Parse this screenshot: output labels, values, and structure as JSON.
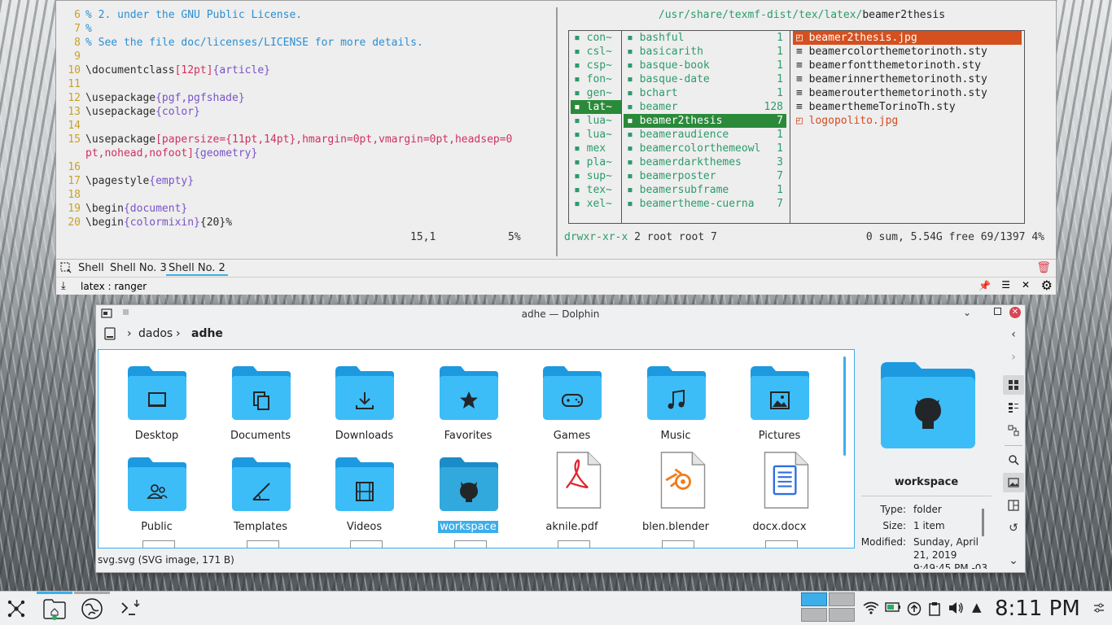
{
  "vim": {
    "lines": [
      {
        "n": "6",
        "parts": [
          {
            "t": "% 2. under the GNU Public License.",
            "c": "c-comment"
          }
        ]
      },
      {
        "n": "7",
        "parts": [
          {
            "t": "%",
            "c": "c-comment"
          }
        ]
      },
      {
        "n": "8",
        "parts": [
          {
            "t": "% See the file doc/licenses/LICENSE for more details.",
            "c": "c-comment"
          }
        ]
      },
      {
        "n": "9",
        "parts": []
      },
      {
        "n": "10",
        "parts": [
          {
            "t": "\\documentclass",
            "c": "c-cmd"
          },
          {
            "t": "[12pt]",
            "c": "c-opt"
          },
          {
            "t": "{article}",
            "c": "c-arg"
          }
        ]
      },
      {
        "n": "11",
        "parts": []
      },
      {
        "n": "12",
        "parts": [
          {
            "t": "\\usepackage",
            "c": "c-cmd"
          },
          {
            "t": "{pgf,pgfshade}",
            "c": "c-arg"
          }
        ]
      },
      {
        "n": "13",
        "parts": [
          {
            "t": "\\usepackage",
            "c": "c-cmd"
          },
          {
            "t": "{color}",
            "c": "c-arg"
          }
        ]
      },
      {
        "n": "14",
        "parts": []
      },
      {
        "n": "15",
        "parts": [
          {
            "t": "\\usepackage",
            "c": "c-cmd"
          },
          {
            "t": "[papersize={11pt,14pt},hmargin=0pt,vmargin=0pt,headsep=0",
            "c": "c-opt"
          }
        ]
      },
      {
        "n": "",
        "parts": [
          {
            "t": "pt,nohead,nofoot]",
            "c": "c-opt"
          },
          {
            "t": "{geometry}",
            "c": "c-arg"
          }
        ]
      },
      {
        "n": "16",
        "parts": []
      },
      {
        "n": "17",
        "parts": [
          {
            "t": "\\pagestyle",
            "c": "c-cmd"
          },
          {
            "t": "{empty}",
            "c": "c-arg"
          }
        ]
      },
      {
        "n": "18",
        "parts": []
      },
      {
        "n": "19",
        "parts": [
          {
            "t": "\\begin",
            "c": "c-cmd"
          },
          {
            "t": "{document}",
            "c": "c-arg"
          }
        ]
      },
      {
        "n": "20",
        "parts": [
          {
            "t": "\\begin",
            "c": "c-cmd"
          },
          {
            "t": "{colormixin}",
            "c": "c-arg"
          },
          {
            "t": "{20}%",
            "c": "c-cmd"
          }
        ]
      }
    ],
    "status_pos": "15,1",
    "status_pct": "5%"
  },
  "ranger": {
    "path_prefix": "/usr/share/texmf-dist/tex/latex/",
    "path_current": "beamer2thesis",
    "parent": [
      "con~",
      "csl~",
      "csp~",
      "fon~",
      "gen~",
      "lat~",
      "lua~",
      "lua~",
      "mex",
      "pla~",
      "sup~",
      "tex~",
      "xel~"
    ],
    "parent_selected": 5,
    "current": [
      {
        "name": "bashful",
        "count": "1"
      },
      {
        "name": "basicarith",
        "count": "1"
      },
      {
        "name": "basque-book",
        "count": "1"
      },
      {
        "name": "basque-date",
        "count": "1"
      },
      {
        "name": "bchart",
        "count": "1"
      },
      {
        "name": "beamer",
        "count": "128"
      },
      {
        "name": "beamer2thesis",
        "count": "7"
      },
      {
        "name": "beameraudience",
        "count": "1"
      },
      {
        "name": "beamercolorthemeowl",
        "count": "1"
      },
      {
        "name": "beamerdarkthemes",
        "count": "3"
      },
      {
        "name": "beamerposter",
        "count": "7"
      },
      {
        "name": "beamersubframe",
        "count": "1"
      },
      {
        "name": "beamertheme-cuerna",
        "count": "7"
      }
    ],
    "current_selected": 6,
    "preview": [
      {
        "name": "beamer2thesis.jpg",
        "kind": "imgsel"
      },
      {
        "name": "beamercolorthemetorinoth.sty",
        "kind": "file"
      },
      {
        "name": "beamerfontthemetorinoth.sty",
        "kind": "file"
      },
      {
        "name": "beamerinnerthemetorinoth.sty",
        "kind": "file"
      },
      {
        "name": "beamerouterthemetorinoth.sty",
        "kind": "file"
      },
      {
        "name": "beamerthemeTorinoTh.sty",
        "kind": "file"
      },
      {
        "name": "logopolito.jpg",
        "kind": "img"
      }
    ],
    "status_perm": "drwxr-xr-x",
    "status_owner": "2 root root 7",
    "status_right": "0 sum, 5.54G free  69/1397   4%"
  },
  "yakuake": {
    "tabs": [
      "Shell",
      "Shell No. 3",
      "Shell No. 2"
    ],
    "active_tab": 2,
    "session_title": "latex : ranger"
  },
  "dolphin": {
    "title": "adhe — Dolphin",
    "crumbs": [
      "dados",
      "adhe"
    ],
    "items": [
      {
        "label": "Desktop",
        "type": "folder",
        "glyph": "desktop-icon"
      },
      {
        "label": "Documents",
        "type": "folder",
        "glyph": "documents-icon"
      },
      {
        "label": "Downloads",
        "type": "folder",
        "glyph": "download-icon"
      },
      {
        "label": "Favorites",
        "type": "folder",
        "glyph": "star-icon"
      },
      {
        "label": "Games",
        "type": "folder",
        "glyph": "gamepad-icon"
      },
      {
        "label": "Music",
        "type": "folder",
        "glyph": "music-icon"
      },
      {
        "label": "Pictures",
        "type": "folder",
        "glyph": "picture-icon"
      },
      {
        "label": "Public",
        "type": "folder",
        "glyph": "people-icon"
      },
      {
        "label": "Templates",
        "type": "folder",
        "glyph": "templates-icon"
      },
      {
        "label": "Videos",
        "type": "folder",
        "glyph": "film-icon"
      },
      {
        "label": "workspace",
        "type": "folder",
        "glyph": "github-icon"
      },
      {
        "label": "aknile.pdf",
        "type": "file",
        "glyph": "pdf-icon"
      },
      {
        "label": "blen.blender",
        "type": "file",
        "glyph": "blender-icon"
      },
      {
        "label": "docx.docx",
        "type": "file",
        "glyph": "document-icon"
      }
    ],
    "selected_index": 10,
    "status": "svg.svg (SVG image, 171 B)",
    "info": {
      "name": "workspace",
      "type_label": "Type:",
      "type_value": "folder",
      "size_label": "Size:",
      "size_value": "1 item",
      "modified_label": "Modified:",
      "modified_value_1": "Sunday, April",
      "modified_value_2": "21, 2019",
      "modified_value_3": "9:49:45 PM -03"
    }
  },
  "taskbar": {
    "clock": "8:11 PM"
  },
  "colors": {
    "accent": "#3daee9",
    "folder_blue": "#1fb2f5",
    "ranger_green": "#2c9b6b",
    "ranger_sel": "#2a8a3a",
    "ranger_img": "#d4501e"
  }
}
